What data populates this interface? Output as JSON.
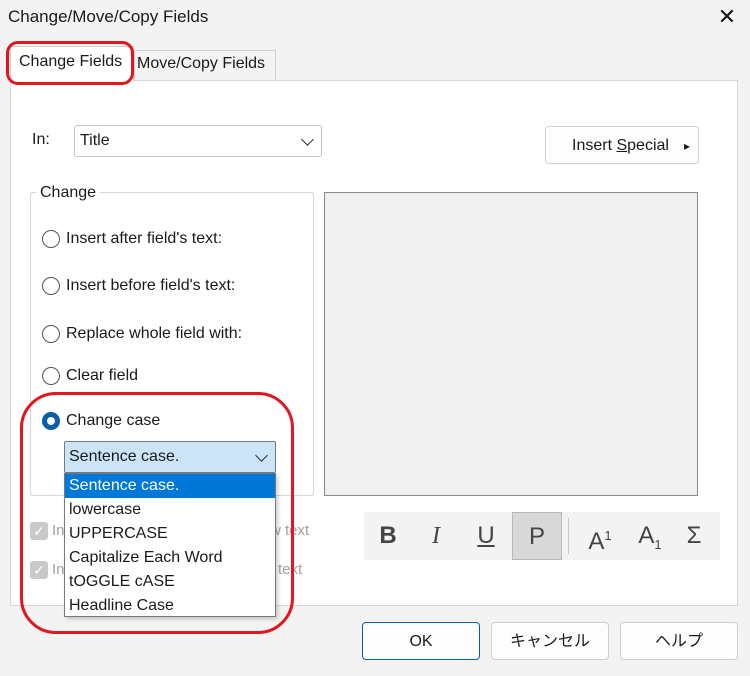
{
  "window": {
    "title": "Change/Move/Copy Fields",
    "close_glyph": "✕"
  },
  "tabs": [
    {
      "label": "Change Fields",
      "active": true
    },
    {
      "label": "Move/Copy Fields",
      "active": false
    }
  ],
  "in_field": {
    "label": "In:",
    "value": "Title"
  },
  "insert_special": {
    "label_pre": "Insert ",
    "label_ul": "S",
    "label_post": "pecial",
    "arrow": "▸"
  },
  "change_group": {
    "title": "Change",
    "options": [
      {
        "label": "Insert after field's text:",
        "selected": false
      },
      {
        "label": "Insert before field's text:",
        "selected": false
      },
      {
        "label": "Replace whole field with:",
        "selected": false
      },
      {
        "label": "Clear field",
        "selected": false
      },
      {
        "label": "Change case",
        "selected": true
      }
    ]
  },
  "case_dropdown": {
    "value": "Sentence case.",
    "options": [
      "Sentence case.",
      "lowercase",
      "UPPERCASE",
      "Capitalize Each Word",
      "tOGGLE cASE",
      "Headline Case"
    ],
    "selected_index": 0
  },
  "checkboxes": [
    {
      "text_start": "In",
      "text_end": "w text",
      "checked": true,
      "disabled": true
    },
    {
      "text_start": "In",
      "text_end": "text",
      "checked": true,
      "disabled": true
    }
  ],
  "format_buttons": [
    {
      "icon": "bold-icon",
      "glyph": "B",
      "pressed": false
    },
    {
      "icon": "italic-icon",
      "glyph": "I",
      "pressed": false
    },
    {
      "icon": "underline-icon",
      "glyph": "U",
      "pressed": false
    },
    {
      "icon": "plain-text-icon",
      "glyph": "P",
      "pressed": true
    },
    {
      "icon": "superscript-icon",
      "glyph": "A",
      "sub": "1",
      "pressed": false
    },
    {
      "icon": "subscript-icon",
      "glyph": "A",
      "sub": "1",
      "pressed": false
    },
    {
      "icon": "symbol-sigma-icon",
      "glyph": "Σ",
      "pressed": false
    }
  ],
  "buttons": {
    "ok": "OK",
    "cancel": "キャンセル",
    "help": "ヘルプ"
  },
  "colors": {
    "accent": "#0b5cad",
    "selection": "#0078d7",
    "annotation": "#e3151f"
  }
}
